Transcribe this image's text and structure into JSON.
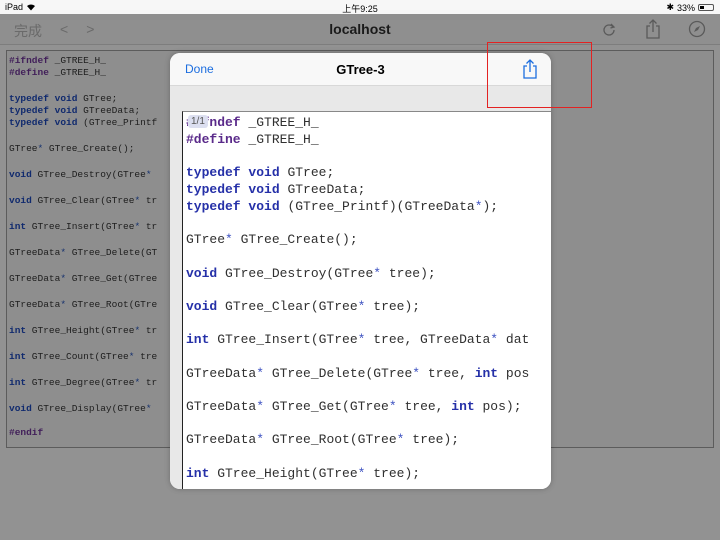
{
  "status_bar": {
    "device": "iPad",
    "time": "上午9:25",
    "battery": "33%",
    "battery_level": 0.33
  },
  "nav": {
    "done": "完成",
    "back": "<",
    "forward": ">",
    "title": "localhost",
    "icons": [
      "reload-icon",
      "share-icon",
      "compass-icon"
    ]
  },
  "modal": {
    "done_label": "Done",
    "title": "GTree-3",
    "page_indicator": "1/1",
    "share_icon": "share-icon"
  },
  "bg_code": [
    "#ifndef _GTREE_H_",
    "#define _GTREE_H_",
    "typedef void GTree;",
    "typedef void GTreeData;",
    "typedef void (GTree_Printf",
    "GTree* GTree_Create();",
    "void GTree_Destroy(GTree*",
    "void GTree_Clear(GTree* tr",
    "int GTree_Insert(GTree* tr",
    "GTreeData* GTree_Delete(GT",
    "GTreeData* GTree_Get(GTree",
    "GTreeData* GTree_Root(GTre",
    "int GTree_Height(GTree* tr",
    "int GTree_Count(GTree* tre",
    "int GTree_Degree(GTree* tr",
    "void GTree_Display(GTree*",
    "#endif"
  ],
  "doc_code": [
    "#ifndef _GTREE_H_",
    "#define _GTREE_H_",
    "typedef void GTree;",
    "typedef void GTreeData;",
    "typedef void (GTree_Printf)(GTreeData*);",
    "GTree* GTree_Create();",
    "void GTree_Destroy(GTree* tree);",
    "void GTree_Clear(GTree* tree);",
    "int GTree_Insert(GTree* tree, GTreeData* dat",
    "GTreeData* GTree_Delete(GTree* tree, int pos",
    "GTreeData* GTree_Get(GTree* tree, int pos);",
    "GTreeData* GTree_Root(GTree* tree);",
    "int GTree_Height(GTree* tree);"
  ]
}
